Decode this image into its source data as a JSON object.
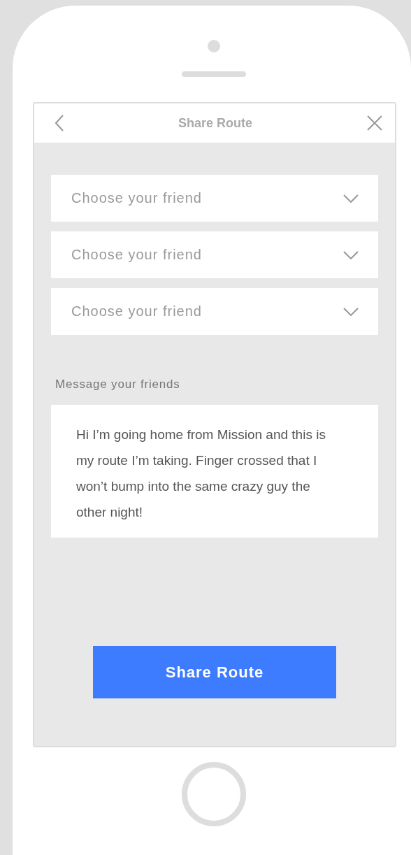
{
  "header": {
    "title": "Share Route"
  },
  "friend_pickers": [
    {
      "placeholder": "Choose your friend"
    },
    {
      "placeholder": "Choose your friend"
    },
    {
      "placeholder": "Choose your friend"
    }
  ],
  "message": {
    "label": "Message your friends",
    "value": "Hi I’m going home from Mission and this is my route I’m taking. Finger crossed that I won’t bump into the same crazy guy the other night!"
  },
  "share_button": {
    "label": "Share Route"
  }
}
